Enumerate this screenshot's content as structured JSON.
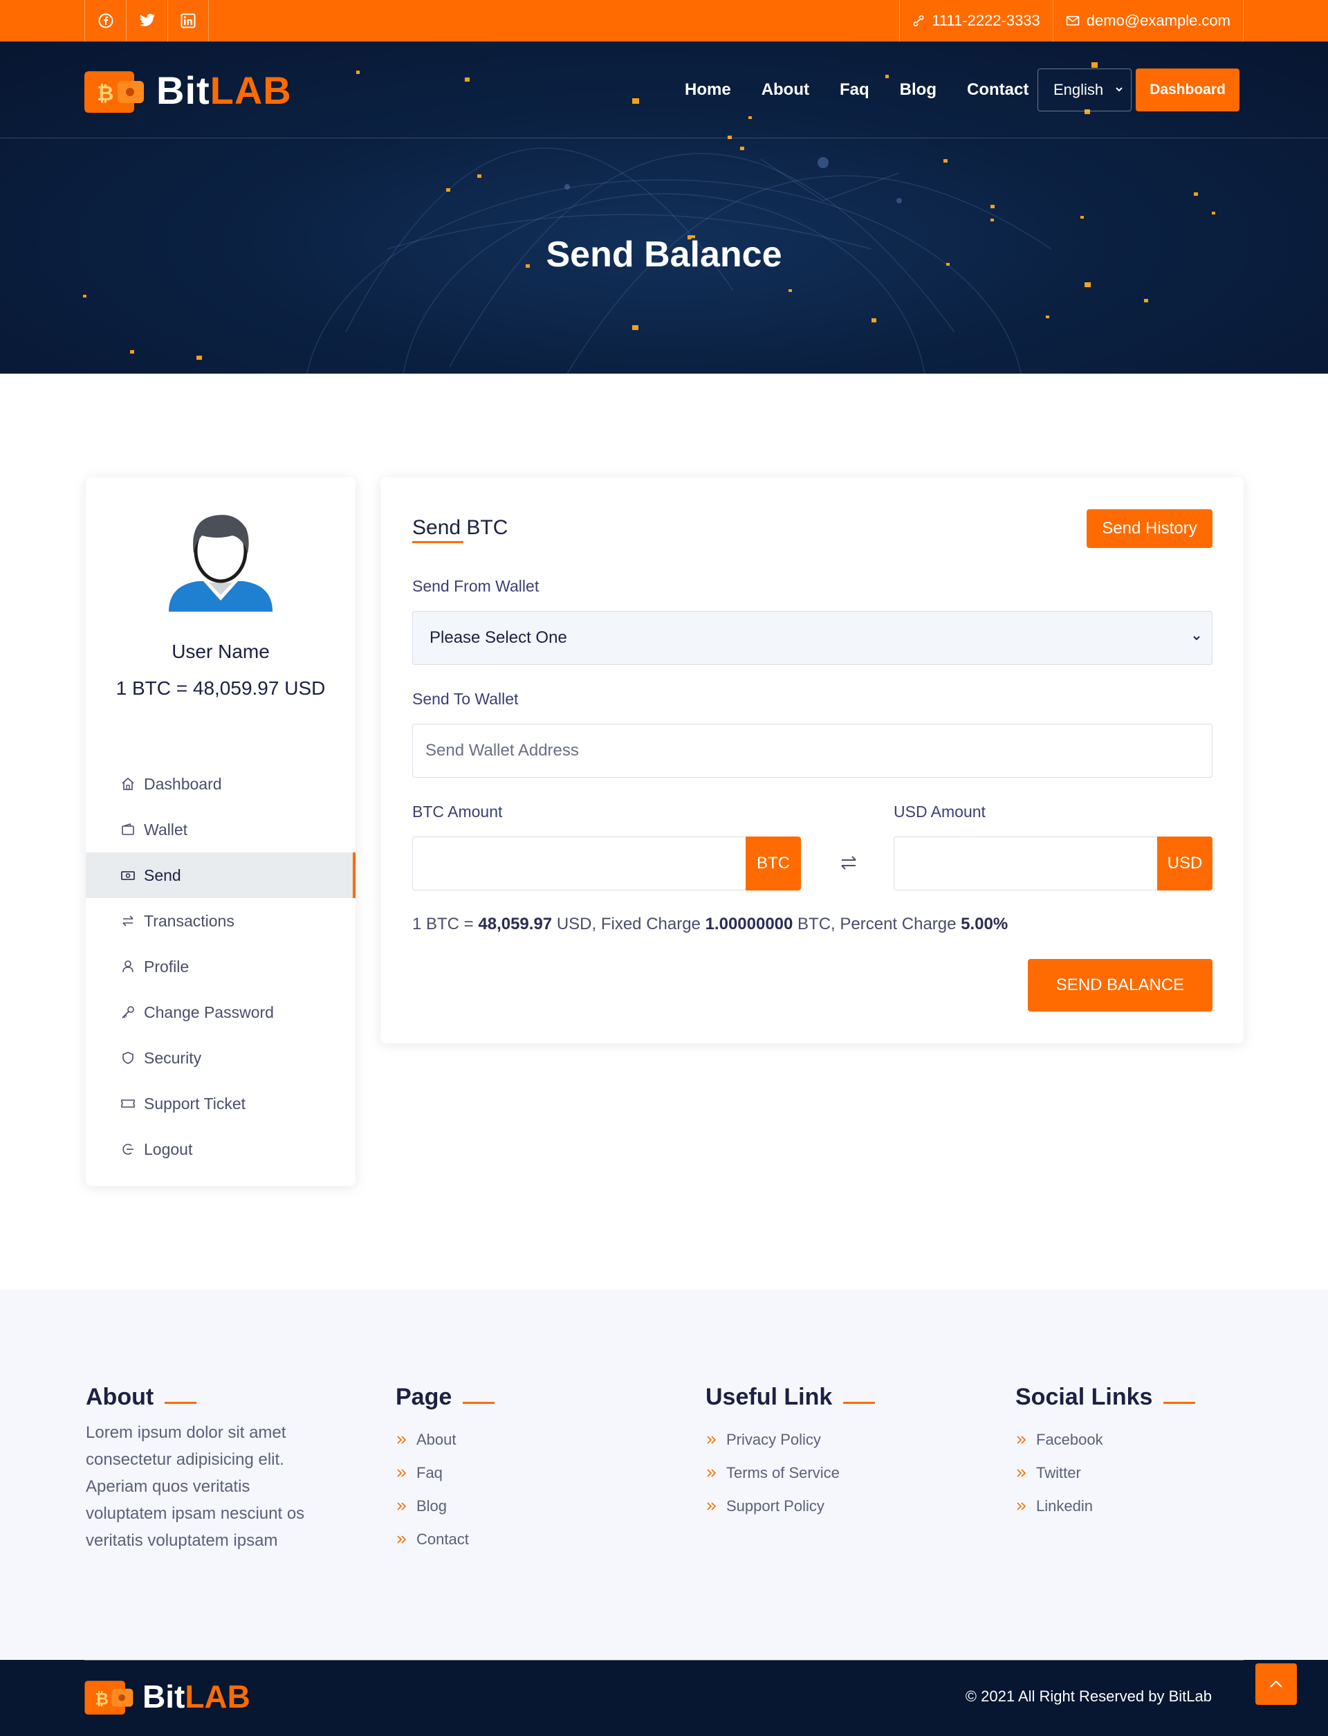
{
  "topbar": {
    "social": [
      {
        "icon": "facebook-icon"
      },
      {
        "icon": "twitter-icon"
      },
      {
        "icon": "linkedin-icon"
      }
    ],
    "phone": "1111-2222-3333",
    "email": "demo@example.com"
  },
  "brand": {
    "name_a": "Bit",
    "name_b": "LAB"
  },
  "nav": {
    "items": [
      "Home",
      "About",
      "Faq",
      "Blog",
      "Contact"
    ],
    "language": "English",
    "dashboard_label": "Dashboard"
  },
  "hero": {
    "title": "Send Balance"
  },
  "sidebar": {
    "user_name": "User Name",
    "rate": "1 BTC = 48,059.97 USD",
    "items": [
      {
        "label": "Dashboard",
        "icon": "home-icon"
      },
      {
        "label": "Wallet",
        "icon": "wallet-icon"
      },
      {
        "label": "Send",
        "icon": "money-icon",
        "active": true
      },
      {
        "label": "Transactions",
        "icon": "swap-icon"
      },
      {
        "label": "Profile",
        "icon": "user-icon"
      },
      {
        "label": "Change Password",
        "icon": "key-icon"
      },
      {
        "label": "Security",
        "icon": "shield-icon"
      },
      {
        "label": "Support Ticket",
        "icon": "ticket-icon"
      },
      {
        "label": "Logout",
        "icon": "logout-icon"
      }
    ]
  },
  "form": {
    "title": "Send BTC",
    "history_label": "Send History",
    "from_label": "Send From Wallet",
    "from_value": "Please Select One",
    "to_label": "Send To Wallet",
    "to_placeholder": "Send Wallet Address",
    "btc_label": "BTC Amount",
    "btc_tag": "BTC",
    "usd_label": "USD Amount",
    "usd_tag": "USD",
    "info": {
      "prefix": "1 BTC = ",
      "rate": "48,059.97",
      "mid1": " USD, Fixed Charge ",
      "fixed": "1.00000000",
      "mid2": " BTC, Percent Charge ",
      "percent": "5.00%"
    },
    "submit_label": "SEND BALANCE"
  },
  "footer": {
    "about_title": "About",
    "about_text": "Lorem ipsum dolor sit amet consectetur adipisicing elit. Aperiam quos veritatis voluptatem ipsam nesciunt os veritatis voluptatem ipsam",
    "page_title": "Page",
    "page_links": [
      "About",
      "Faq",
      "Blog",
      "Contact"
    ],
    "useful_title": "Useful Link",
    "useful_links": [
      "Privacy Policy",
      "Terms of Service",
      "Support Policy"
    ],
    "social_title": "Social Links",
    "social_links": [
      "Facebook",
      "Twitter",
      "Linkedin"
    ],
    "copyright": "© 2021 All Right Reserved by BitLab"
  },
  "colors": {
    "accent": "#ff6b00",
    "navy": "#0b2142"
  }
}
